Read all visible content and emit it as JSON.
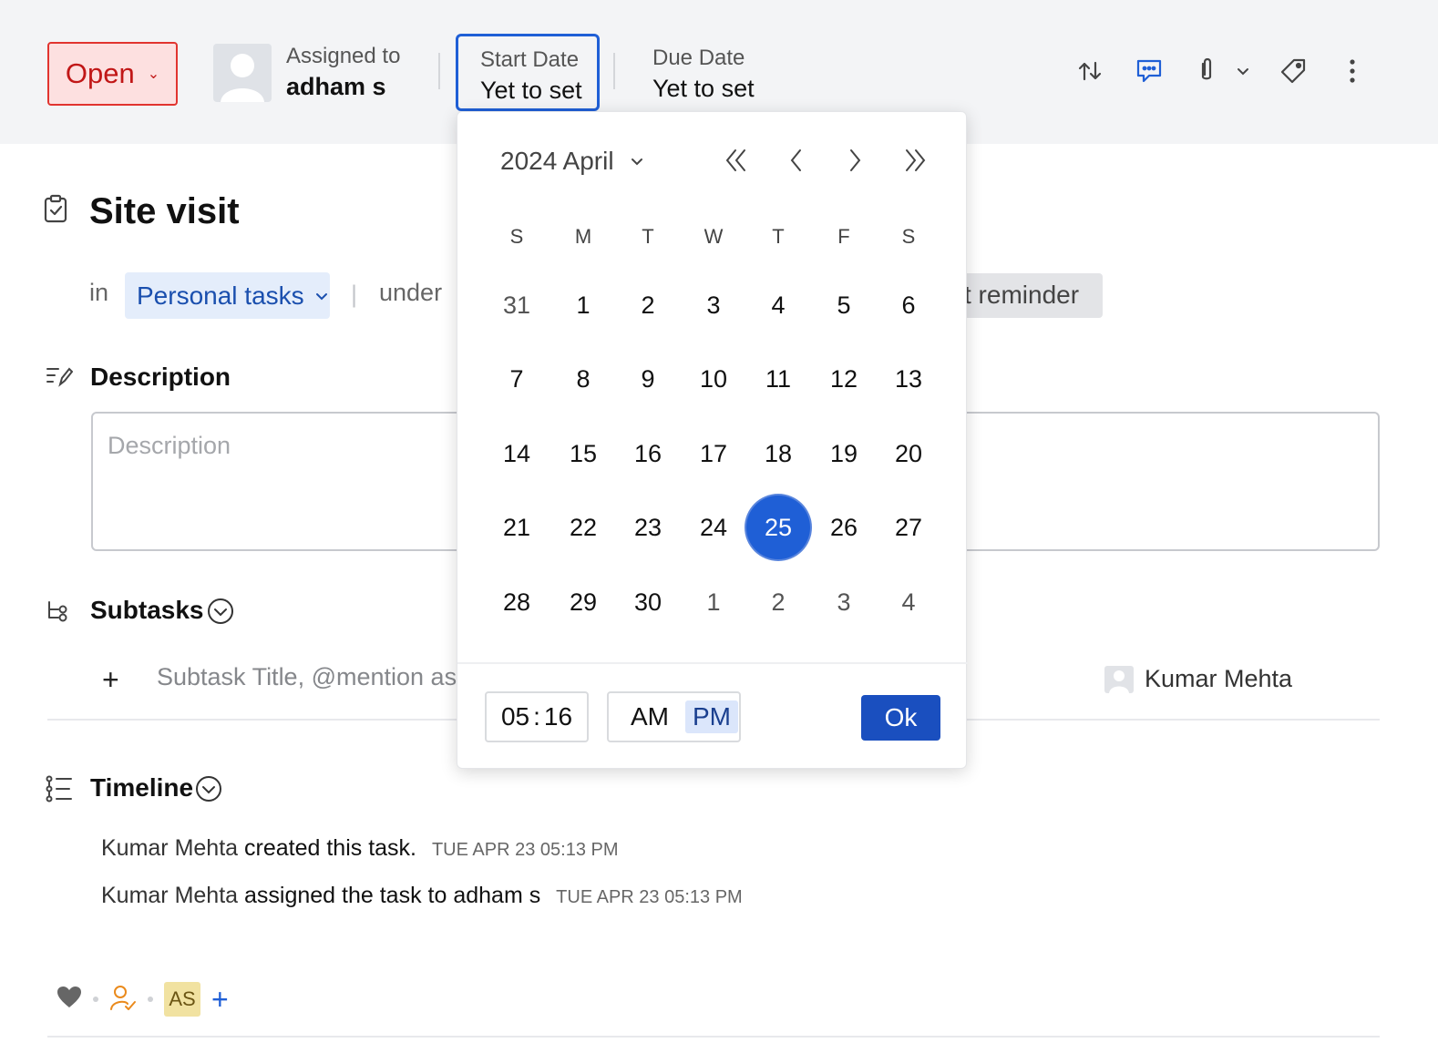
{
  "header": {
    "status_label": "Open",
    "assignee_label": "Assigned to",
    "assignee_name": "adham s",
    "start_date_label": "Start Date",
    "start_date_value": "Yet to set",
    "due_date_label": "Due Date",
    "due_date_value": "Yet to set",
    "icons": [
      "swap-icon",
      "chat-icon",
      "paperclip-icon",
      "chevron-down-icon",
      "tag-icon",
      "more-vertical-icon"
    ]
  },
  "task": {
    "title": "Site visit",
    "in_label": "in",
    "project": "Personal tasks",
    "under_label": "under",
    "reminder_label": "t reminder"
  },
  "description": {
    "heading": "Description",
    "placeholder": "Description"
  },
  "subtasks": {
    "heading": "Subtasks",
    "input_placeholder": "Subtask Title, @mention as",
    "owner": "Kumar Mehta"
  },
  "timeline": {
    "heading": "Timeline",
    "entries": [
      {
        "actor": "Kumar Mehta",
        "action": "created this task.",
        "timestamp": "TUE APR 23 05:13 PM"
      },
      {
        "actor": "Kumar Mehta",
        "action": "assigned the task to adham s",
        "timestamp": "TUE APR 23 05:13 PM"
      }
    ]
  },
  "footer": {
    "avatar_initials": "AS",
    "add_label": "+"
  },
  "picker": {
    "month_label": "2024 April",
    "weekdays": [
      "S",
      "M",
      "T",
      "W",
      "T",
      "F",
      "S"
    ],
    "weeks": [
      [
        "31",
        "1",
        "2",
        "3",
        "4",
        "5",
        "6"
      ],
      [
        "7",
        "8",
        "9",
        "10",
        "11",
        "12",
        "13"
      ],
      [
        "14",
        "15",
        "16",
        "17",
        "18",
        "19",
        "20"
      ],
      [
        "21",
        "22",
        "23",
        "24",
        "25",
        "26",
        "27"
      ],
      [
        "28",
        "29",
        "30",
        "1",
        "2",
        "3",
        "4"
      ]
    ],
    "selected_day": "25",
    "time_hours": "05",
    "time_sep": ":",
    "time_minutes": "16",
    "am_label": "AM",
    "pm_label": "PM",
    "active_period": "PM",
    "ok_label": "Ok",
    "accent_color": "#1f5fd6"
  }
}
